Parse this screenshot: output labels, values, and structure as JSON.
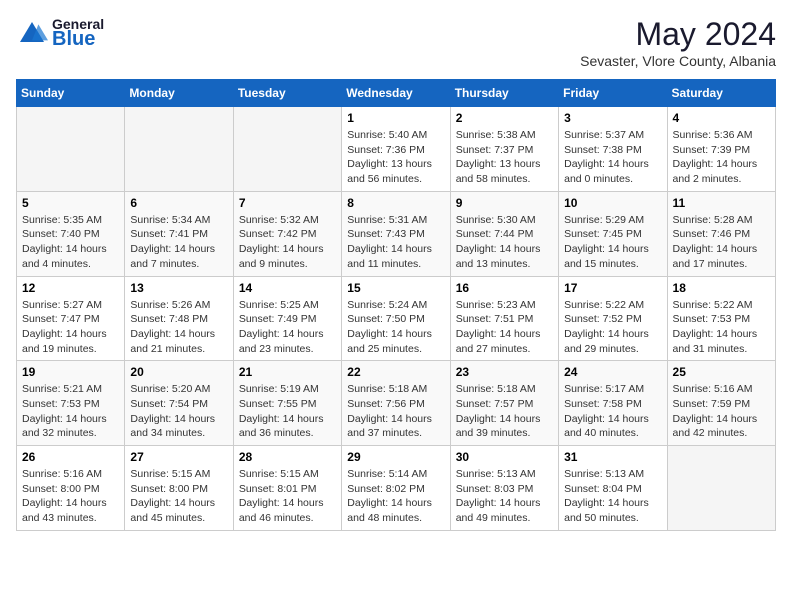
{
  "header": {
    "logo_general": "General",
    "logo_blue": "Blue",
    "month_year": "May 2024",
    "location": "Sevaster, Vlore County, Albania"
  },
  "days_of_week": [
    "Sunday",
    "Monday",
    "Tuesday",
    "Wednesday",
    "Thursday",
    "Friday",
    "Saturday"
  ],
  "weeks": [
    [
      {
        "num": "",
        "info": ""
      },
      {
        "num": "",
        "info": ""
      },
      {
        "num": "",
        "info": ""
      },
      {
        "num": "1",
        "info": "Sunrise: 5:40 AM\nSunset: 7:36 PM\nDaylight: 13 hours and 56 minutes."
      },
      {
        "num": "2",
        "info": "Sunrise: 5:38 AM\nSunset: 7:37 PM\nDaylight: 13 hours and 58 minutes."
      },
      {
        "num": "3",
        "info": "Sunrise: 5:37 AM\nSunset: 7:38 PM\nDaylight: 14 hours and 0 minutes."
      },
      {
        "num": "4",
        "info": "Sunrise: 5:36 AM\nSunset: 7:39 PM\nDaylight: 14 hours and 2 minutes."
      }
    ],
    [
      {
        "num": "5",
        "info": "Sunrise: 5:35 AM\nSunset: 7:40 PM\nDaylight: 14 hours and 4 minutes."
      },
      {
        "num": "6",
        "info": "Sunrise: 5:34 AM\nSunset: 7:41 PM\nDaylight: 14 hours and 7 minutes."
      },
      {
        "num": "7",
        "info": "Sunrise: 5:32 AM\nSunset: 7:42 PM\nDaylight: 14 hours and 9 minutes."
      },
      {
        "num": "8",
        "info": "Sunrise: 5:31 AM\nSunset: 7:43 PM\nDaylight: 14 hours and 11 minutes."
      },
      {
        "num": "9",
        "info": "Sunrise: 5:30 AM\nSunset: 7:44 PM\nDaylight: 14 hours and 13 minutes."
      },
      {
        "num": "10",
        "info": "Sunrise: 5:29 AM\nSunset: 7:45 PM\nDaylight: 14 hours and 15 minutes."
      },
      {
        "num": "11",
        "info": "Sunrise: 5:28 AM\nSunset: 7:46 PM\nDaylight: 14 hours and 17 minutes."
      }
    ],
    [
      {
        "num": "12",
        "info": "Sunrise: 5:27 AM\nSunset: 7:47 PM\nDaylight: 14 hours and 19 minutes."
      },
      {
        "num": "13",
        "info": "Sunrise: 5:26 AM\nSunset: 7:48 PM\nDaylight: 14 hours and 21 minutes."
      },
      {
        "num": "14",
        "info": "Sunrise: 5:25 AM\nSunset: 7:49 PM\nDaylight: 14 hours and 23 minutes."
      },
      {
        "num": "15",
        "info": "Sunrise: 5:24 AM\nSunset: 7:50 PM\nDaylight: 14 hours and 25 minutes."
      },
      {
        "num": "16",
        "info": "Sunrise: 5:23 AM\nSunset: 7:51 PM\nDaylight: 14 hours and 27 minutes."
      },
      {
        "num": "17",
        "info": "Sunrise: 5:22 AM\nSunset: 7:52 PM\nDaylight: 14 hours and 29 minutes."
      },
      {
        "num": "18",
        "info": "Sunrise: 5:22 AM\nSunset: 7:53 PM\nDaylight: 14 hours and 31 minutes."
      }
    ],
    [
      {
        "num": "19",
        "info": "Sunrise: 5:21 AM\nSunset: 7:53 PM\nDaylight: 14 hours and 32 minutes."
      },
      {
        "num": "20",
        "info": "Sunrise: 5:20 AM\nSunset: 7:54 PM\nDaylight: 14 hours and 34 minutes."
      },
      {
        "num": "21",
        "info": "Sunrise: 5:19 AM\nSunset: 7:55 PM\nDaylight: 14 hours and 36 minutes."
      },
      {
        "num": "22",
        "info": "Sunrise: 5:18 AM\nSunset: 7:56 PM\nDaylight: 14 hours and 37 minutes."
      },
      {
        "num": "23",
        "info": "Sunrise: 5:18 AM\nSunset: 7:57 PM\nDaylight: 14 hours and 39 minutes."
      },
      {
        "num": "24",
        "info": "Sunrise: 5:17 AM\nSunset: 7:58 PM\nDaylight: 14 hours and 40 minutes."
      },
      {
        "num": "25",
        "info": "Sunrise: 5:16 AM\nSunset: 7:59 PM\nDaylight: 14 hours and 42 minutes."
      }
    ],
    [
      {
        "num": "26",
        "info": "Sunrise: 5:16 AM\nSunset: 8:00 PM\nDaylight: 14 hours and 43 minutes."
      },
      {
        "num": "27",
        "info": "Sunrise: 5:15 AM\nSunset: 8:00 PM\nDaylight: 14 hours and 45 minutes."
      },
      {
        "num": "28",
        "info": "Sunrise: 5:15 AM\nSunset: 8:01 PM\nDaylight: 14 hours and 46 minutes."
      },
      {
        "num": "29",
        "info": "Sunrise: 5:14 AM\nSunset: 8:02 PM\nDaylight: 14 hours and 48 minutes."
      },
      {
        "num": "30",
        "info": "Sunrise: 5:13 AM\nSunset: 8:03 PM\nDaylight: 14 hours and 49 minutes."
      },
      {
        "num": "31",
        "info": "Sunrise: 5:13 AM\nSunset: 8:04 PM\nDaylight: 14 hours and 50 minutes."
      },
      {
        "num": "",
        "info": ""
      }
    ]
  ]
}
